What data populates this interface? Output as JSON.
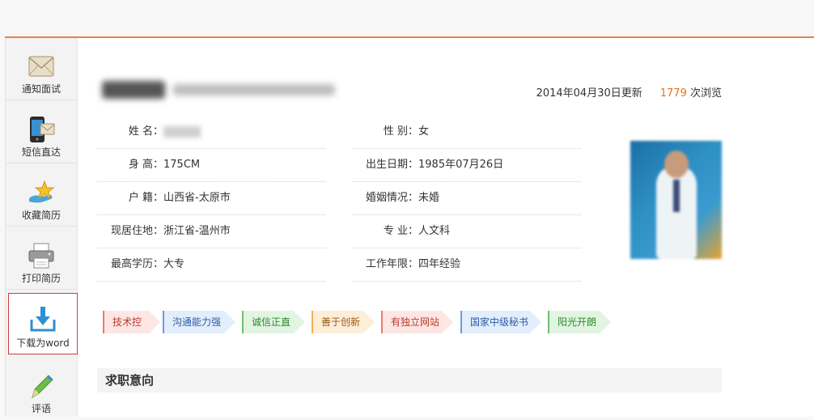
{
  "sidebar": {
    "items": [
      {
        "label": "通知面试",
        "icon": "envelope-icon"
      },
      {
        "label": "短信直达",
        "icon": "phone-sms-icon"
      },
      {
        "label": "收藏简历",
        "icon": "favorite-star-icon"
      },
      {
        "label": "打印简历",
        "icon": "printer-icon"
      },
      {
        "label": "下载为word",
        "icon": "download-icon"
      },
      {
        "label": "评语",
        "icon": "pencil-icon"
      }
    ]
  },
  "header": {
    "updated": "2014年04月30日更新",
    "views_count": "1779",
    "views_suffix": "次浏览"
  },
  "info": {
    "name_label": "姓    名：",
    "gender_label": "性    别：",
    "gender": "女",
    "height_label": "身    高：",
    "height": "175CM",
    "birth_label": "出生日期：",
    "birth": "1985年07月26日",
    "hukou_label": "户    籍：",
    "hukou": "山西省-太原市",
    "marriage_label": "婚姻情况：",
    "marriage": "未婚",
    "residence_label": "现居住地：",
    "residence": "浙江省-温州市",
    "major_label": "专    业：",
    "major": "人文科",
    "education_label": "最高学历：",
    "education": "大专",
    "experience_label": "工作年限：",
    "experience": "四年经验"
  },
  "tags": [
    "技术控",
    "沟通能力强",
    "诚信正直",
    "善于创新",
    "有独立网站",
    "国家中级秘书",
    "阳光开朗"
  ],
  "section": {
    "title": "求职意向"
  },
  "colors": {
    "accent": "#e8834a",
    "views": "#e8731f",
    "active_border": "#d23a3a"
  }
}
